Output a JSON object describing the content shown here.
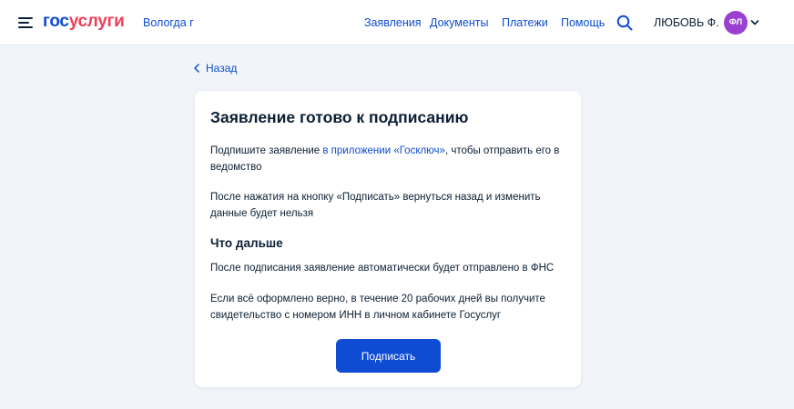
{
  "header": {
    "logo_part1": "гос",
    "logo_part2": "услуги",
    "city": "Вологда г",
    "nav": [
      "Заявления",
      "Документы",
      "Платежи",
      "Помощь"
    ],
    "user_name": "ЛЮБОВЬ Ф.",
    "avatar_initials": "ФЛ",
    "icons": [
      "menu-icon",
      "search-icon",
      "chevron-down-icon"
    ]
  },
  "back_label": "Назад",
  "card": {
    "title": "Заявление готово к подписанию",
    "p1_before": "Подпишите заявление ",
    "p1_link": "в приложении «Госключ»",
    "p1_after": ", чтобы отправить его в ведомство",
    "p2": "После нажатия на кнопку «Подписать» вернуться назад и изменить данные будет нельзя",
    "subheading": "Что дальше",
    "p3": "После подписания заявление автоматически будет отправлено в ФНС",
    "p4": "Если всё оформлено верно, в течение 20 рабочих дней вы получите свидетельство с номером ИНН в личном кабинете Госуслуг",
    "sign_button": "Подписать"
  },
  "colors": {
    "accent": "#0d4cd3",
    "logo_red": "#ee3f58",
    "avatar": "#9b3fd1",
    "background": "#f1f4f8"
  }
}
